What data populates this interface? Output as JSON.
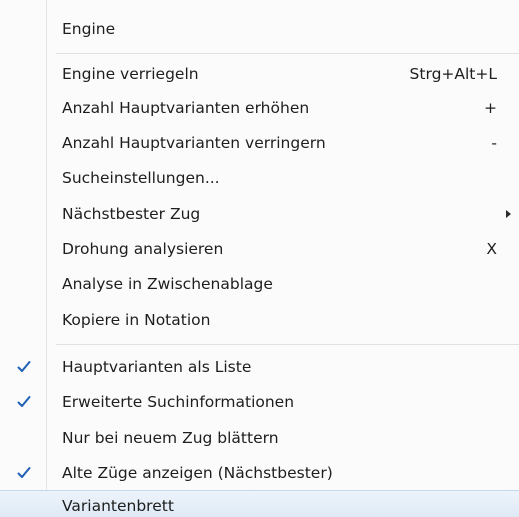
{
  "menu": {
    "header": "Engine",
    "items": [
      {
        "label": "Engine verriegeln",
        "shortcut": "Strg+Alt+L"
      },
      {
        "label": "Anzahl Hauptvarianten erhöhen",
        "shortcut": "+"
      },
      {
        "label": "Anzahl Hauptvarianten verringern",
        "shortcut": "-"
      },
      {
        "label": "Sucheinstellungen..."
      },
      {
        "label": "Nächstbester Zug",
        "submenu": true
      },
      {
        "label": "Drohung analysieren",
        "shortcut": "X"
      },
      {
        "label": "Analyse in Zwischenablage"
      },
      {
        "label": "Kopiere in Notation"
      },
      {
        "label": "Hauptvarianten als Liste",
        "checked": true
      },
      {
        "label": "Erweiterte Suchinformationen",
        "checked": true
      },
      {
        "label": "Nur bei neuem Zug blättern",
        "checked": false
      },
      {
        "label": "Alte Züge anzeigen (Nächstbester)",
        "checked": true
      },
      {
        "label": "Variantenbrett",
        "highlighted": true
      }
    ]
  },
  "colors": {
    "check": "#1f5fb5",
    "highlight": "#dde9f6"
  },
  "icons": {
    "checkmark": "check-icon",
    "submenu": "chevron-right-icon"
  }
}
